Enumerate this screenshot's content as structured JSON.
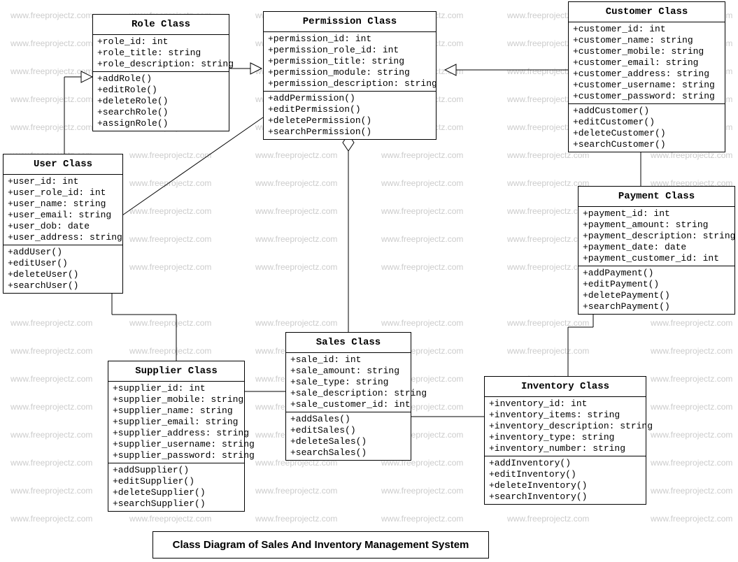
{
  "watermark": "www.freeprojectz.com",
  "caption": "Class Diagram of Sales And Inventory Management System",
  "classes": {
    "role": {
      "title": "Role Class",
      "attrs": [
        "+role_id: int",
        "+role_title: string",
        "+role_description: string"
      ],
      "ops": [
        "+addRole()",
        "+editRole()",
        "+deleteRole()",
        "+searchRole()",
        "+assignRole()"
      ]
    },
    "permission": {
      "title": "Permission Class",
      "attrs": [
        "+permission_id: int",
        "+permission_role_id: int",
        "+permission_title: string",
        "+permission_module: string",
        "+permission_description: string"
      ],
      "ops": [
        "+addPermission()",
        "+editPermission()",
        "+deletePermission()",
        "+searchPermission()"
      ]
    },
    "customer": {
      "title": "Customer Class",
      "attrs": [
        "+customer_id: int",
        "+customer_name: string",
        "+customer_mobile: string",
        "+customer_email: string",
        "+customer_address: string",
        "+customer_username: string",
        "+customer_password: string"
      ],
      "ops": [
        "+addCustomer()",
        "+editCustomer()",
        "+deleteCustomer()",
        "+searchCustomer()"
      ]
    },
    "user": {
      "title": "User Class",
      "attrs": [
        "+user_id: int",
        "+user_role_id: int",
        "+user_name: string",
        "+user_email: string",
        "+user_dob: date",
        "+user_address: string"
      ],
      "ops": [
        "+addUser()",
        "+editUser()",
        "+deleteUser()",
        "+searchUser()"
      ]
    },
    "payment": {
      "title": "Payment Class",
      "attrs": [
        "+payment_id: int",
        "+payment_amount: string",
        "+payment_description: string",
        "+payment_date: date",
        "+payment_customer_id: int"
      ],
      "ops": [
        "+addPayment()",
        "+editPayment()",
        "+deletePayment()",
        "+searchPayment()"
      ]
    },
    "sales": {
      "title": "Sales Class",
      "attrs": [
        "+sale_id: int",
        "+sale_amount: string",
        "+sale_type: string",
        "+sale_description: string",
        "+sale_customer_id: int"
      ],
      "ops": [
        "+addSales()",
        "+editSales()",
        "+deleteSales()",
        "+searchSales()"
      ]
    },
    "supplier": {
      "title": "Supplier Class",
      "attrs": [
        "+supplier_id: int",
        "+supplier_mobile: string",
        "+supplier_name: string",
        "+supplier_email: string",
        "+supplier_address: string",
        "+supplier_username: string",
        "+supplier_password: string"
      ],
      "ops": [
        "+addSupplier()",
        "+editSupplier()",
        "+deleteSupplier()",
        "+searchSupplier()"
      ]
    },
    "inventory": {
      "title": "Inventory Class",
      "attrs": [
        "+inventory_id: int",
        "+inventory_items: string",
        "+inventory_description: string",
        "+inventory_type: string",
        "+inventory_number: string"
      ],
      "ops": [
        "+addInventory()",
        "+editInventory()",
        "+deleteInventory()",
        "+searchInventory()"
      ]
    }
  }
}
